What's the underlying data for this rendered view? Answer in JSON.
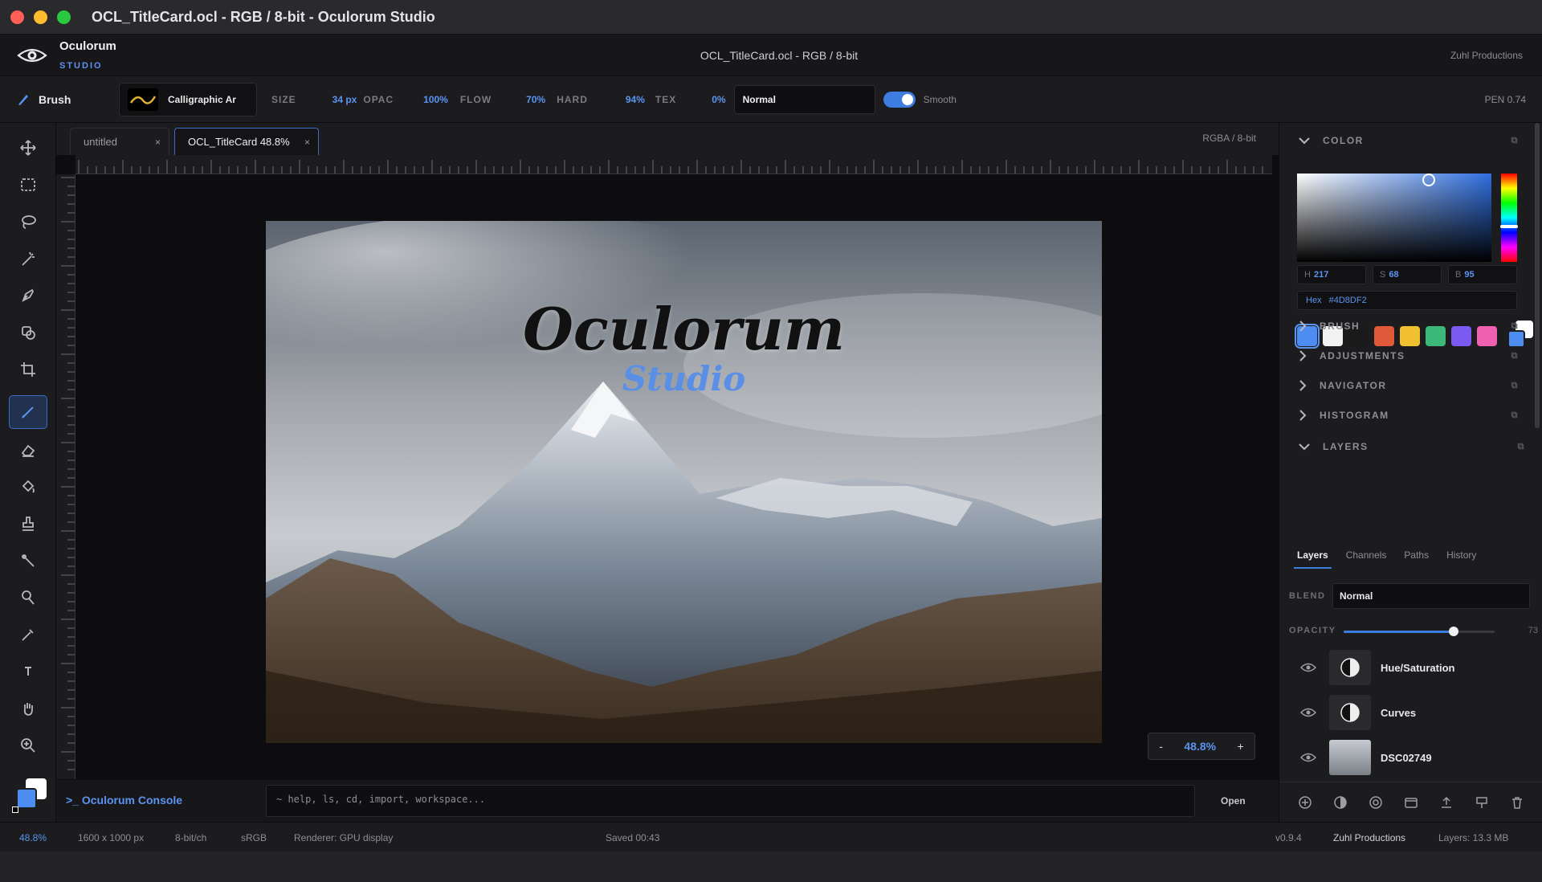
{
  "window": {
    "title": "OCL_TitleCard.ocl - RGB / 8-bit - Oculorum Studio"
  },
  "header": {
    "brand": "Oculorum",
    "brand_sub": "STUDIO",
    "doc_title": "OCL_TitleCard.ocl - RGB / 8-bit",
    "right_label": "Zuhl Productions"
  },
  "options": {
    "tool": "Brush",
    "preset": "Calligraphic Ar",
    "size_label": "SIZE",
    "size": "34 px",
    "opac_label": "OPAC",
    "opac": "100%",
    "flow_label": "FLOW",
    "flow": "70%",
    "hard_label": "HARD",
    "hard": "94%",
    "tex_label": "TEX",
    "tex": "0%",
    "blend": "Normal",
    "smooth_label": "Smooth",
    "pen": "PEN 0.74"
  },
  "tabs": [
    {
      "label": "untitled",
      "close": "×"
    },
    {
      "label": "OCL_TitleCard 48.8%",
      "close": "×"
    }
  ],
  "doc": {
    "color_mode": "RGBA / 8-bit",
    "zoom": "48.8%",
    "zoom_minus": "-",
    "zoom_plus": "+"
  },
  "hero": {
    "title": "Oculorum",
    "subtitle": "Studio"
  },
  "console": {
    "label": ">_ Oculorum Console",
    "placeholder": "~ help, ls, cd, import, workspace...",
    "open": "Open"
  },
  "status": {
    "zoom": "48.8%",
    "dimensions": "1600 x 1000 px",
    "depth": "8-bit/ch",
    "profile": "sRGB",
    "renderer": "Renderer: GPU display",
    "saved": "Saved 00:43",
    "version": "v0.9.4",
    "org": "Zuhl Productions",
    "layers_mem": "Layers: 13.3 MB"
  },
  "panel": {
    "color_title": "COLOR",
    "h_label": "H",
    "h": "217",
    "s_label": "S",
    "s": "68",
    "b_label": "B",
    "b": "95",
    "hex_label": "Hex",
    "hex": "#4D8DF2",
    "swatches": [
      "#4d8df2",
      "#f2f2f2",
      "#1a1a1a",
      "#e05a3a",
      "#f0c030",
      "#3cb87a",
      "#7a5af0",
      "#f060b0"
    ],
    "sections": [
      "BRUSH",
      "ADJUSTMENTS",
      "NAVIGATOR",
      "HISTOGRAM"
    ],
    "layers_title": "LAYERS",
    "layer_tabs": [
      "Layers",
      "Channels",
      "Paths",
      "History"
    ],
    "blend_label": "BLEND",
    "blend": "Normal",
    "opacity_label": "OPACITY",
    "opacity": "73",
    "opacity_fraction": 0.73,
    "layers": [
      {
        "name": "Hue/Saturation"
      },
      {
        "name": "Curves"
      },
      {
        "name": "DSC02749"
      }
    ]
  },
  "colors": {
    "accent": "#4d8df2",
    "panel_bg": "#1c1c1f",
    "canvas_bg": "#0d0d0f"
  }
}
